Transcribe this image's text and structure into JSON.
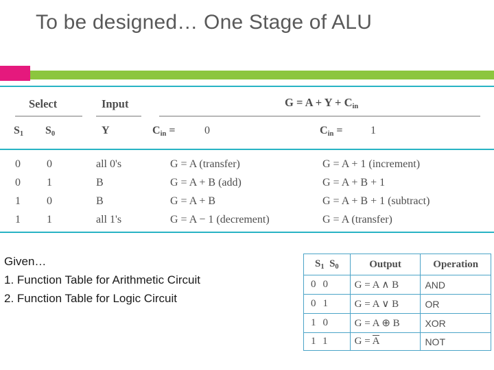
{
  "slide": {
    "title": "To be designed… One Stage of ALU",
    "accent_green": "#8cc63e",
    "accent_pink": "#e5197d",
    "rule_color": "#27b3c4"
  },
  "arithmetic_table": {
    "headers": {
      "select": "Select",
      "input": "Input",
      "g": "G = A + Y + C",
      "g_sub": "in"
    },
    "subheaders": {
      "s1": "S",
      "s1_sub": "1",
      "s0": "S",
      "s0_sub": "0",
      "y": "Y",
      "cin_left": "C",
      "cin_left_sub": "in",
      "cin_left_eq": "=",
      "cin_left_val": "0",
      "cin_right": "C",
      "cin_right_sub": "in",
      "cin_right_eq": "=",
      "cin_right_val": "1"
    },
    "rows": [
      {
        "s1": "0",
        "s0": "0",
        "y": "all 0's",
        "g_cin0": "G = A  (transfer)",
        "g_cin1": "G = A + 1  (increment)"
      },
      {
        "s1": "0",
        "s0": "1",
        "y": "B",
        "g_cin0": "G = A + B  (add)",
        "g_cin1": "G = A + B + 1"
      },
      {
        "s1": "1",
        "s0": "0",
        "y": "B",
        "g_cin0": "G = A + B",
        "g_cin1": "G = A + B + 1  (subtract)"
      },
      {
        "s1": "1",
        "s0": "1",
        "y": "all 1's",
        "g_cin0": "G = A − 1  (decrement)",
        "g_cin1": "G = A  (transfer)"
      }
    ]
  },
  "given": {
    "heading": "Given…",
    "items": [
      "1.  Function Table for Arithmetic Circuit",
      "2.  Function Table for Logic Circuit"
    ]
  },
  "logic_table": {
    "headers": [
      "S₁ S₀",
      "Output",
      "Operation"
    ],
    "header_s": "S",
    "rows": [
      {
        "s1": "0",
        "s0": "0",
        "output": "G = A ∧ B",
        "operation": "AND"
      },
      {
        "s1": "0",
        "s0": "1",
        "output": "G = A ∨ B",
        "operation": "OR"
      },
      {
        "s1": "1",
        "s0": "0",
        "output": "G = A ⊕ B",
        "operation": "XOR"
      },
      {
        "s1": "1",
        "s0": "1",
        "output": "G = A",
        "operation": "NOT"
      }
    ],
    "border_color": "#4aa3c7"
  }
}
